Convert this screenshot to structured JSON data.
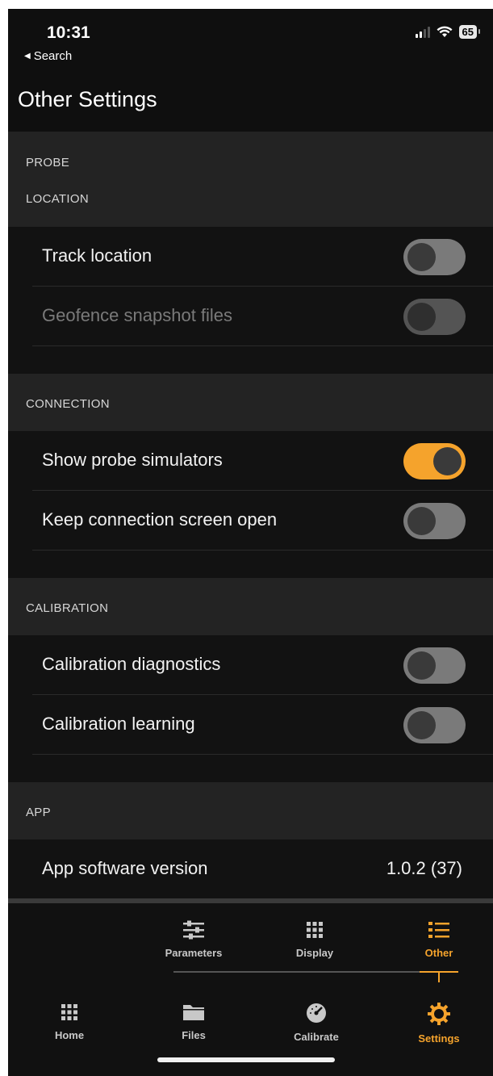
{
  "status_bar": {
    "time": "10:31",
    "back_label": "Search",
    "battery": "65"
  },
  "page": {
    "title": "Other Settings"
  },
  "sections": {
    "probe": {
      "label": "PROBE"
    },
    "location": {
      "label": "LOCATION",
      "rows": [
        {
          "label": "Track location",
          "state": "off",
          "enabled": true
        },
        {
          "label": "Geofence snapshot files",
          "state": "off",
          "enabled": false
        }
      ]
    },
    "connection": {
      "label": "CONNECTION",
      "rows": [
        {
          "label": "Show probe simulators",
          "state": "on",
          "enabled": true
        },
        {
          "label": "Keep connection screen open",
          "state": "off",
          "enabled": true
        }
      ]
    },
    "calibration": {
      "label": "CALIBRATION",
      "rows": [
        {
          "label": "Calibration diagnostics",
          "state": "off",
          "enabled": true
        },
        {
          "label": "Calibration learning",
          "state": "off",
          "enabled": true
        }
      ]
    },
    "app": {
      "label": "APP",
      "rows": [
        {
          "label": "App software version",
          "value": "1.0.2 (37)"
        }
      ]
    }
  },
  "sub_tabs": [
    {
      "label": "Parameters",
      "icon": "sliders-icon",
      "active": false
    },
    {
      "label": "Display",
      "icon": "grid-icon",
      "active": false
    },
    {
      "label": "Other",
      "icon": "list-icon",
      "active": true
    }
  ],
  "main_tabs": [
    {
      "label": "Home",
      "icon": "grid-icon",
      "active": false
    },
    {
      "label": "Files",
      "icon": "folder-icon",
      "active": false
    },
    {
      "label": "Calibrate",
      "icon": "gauge-icon",
      "active": false
    },
    {
      "label": "Settings",
      "icon": "gear-icon",
      "active": true
    }
  ],
  "colors": {
    "accent": "#f5a32c",
    "background": "#0f0f0f",
    "section_header": "#232323"
  }
}
